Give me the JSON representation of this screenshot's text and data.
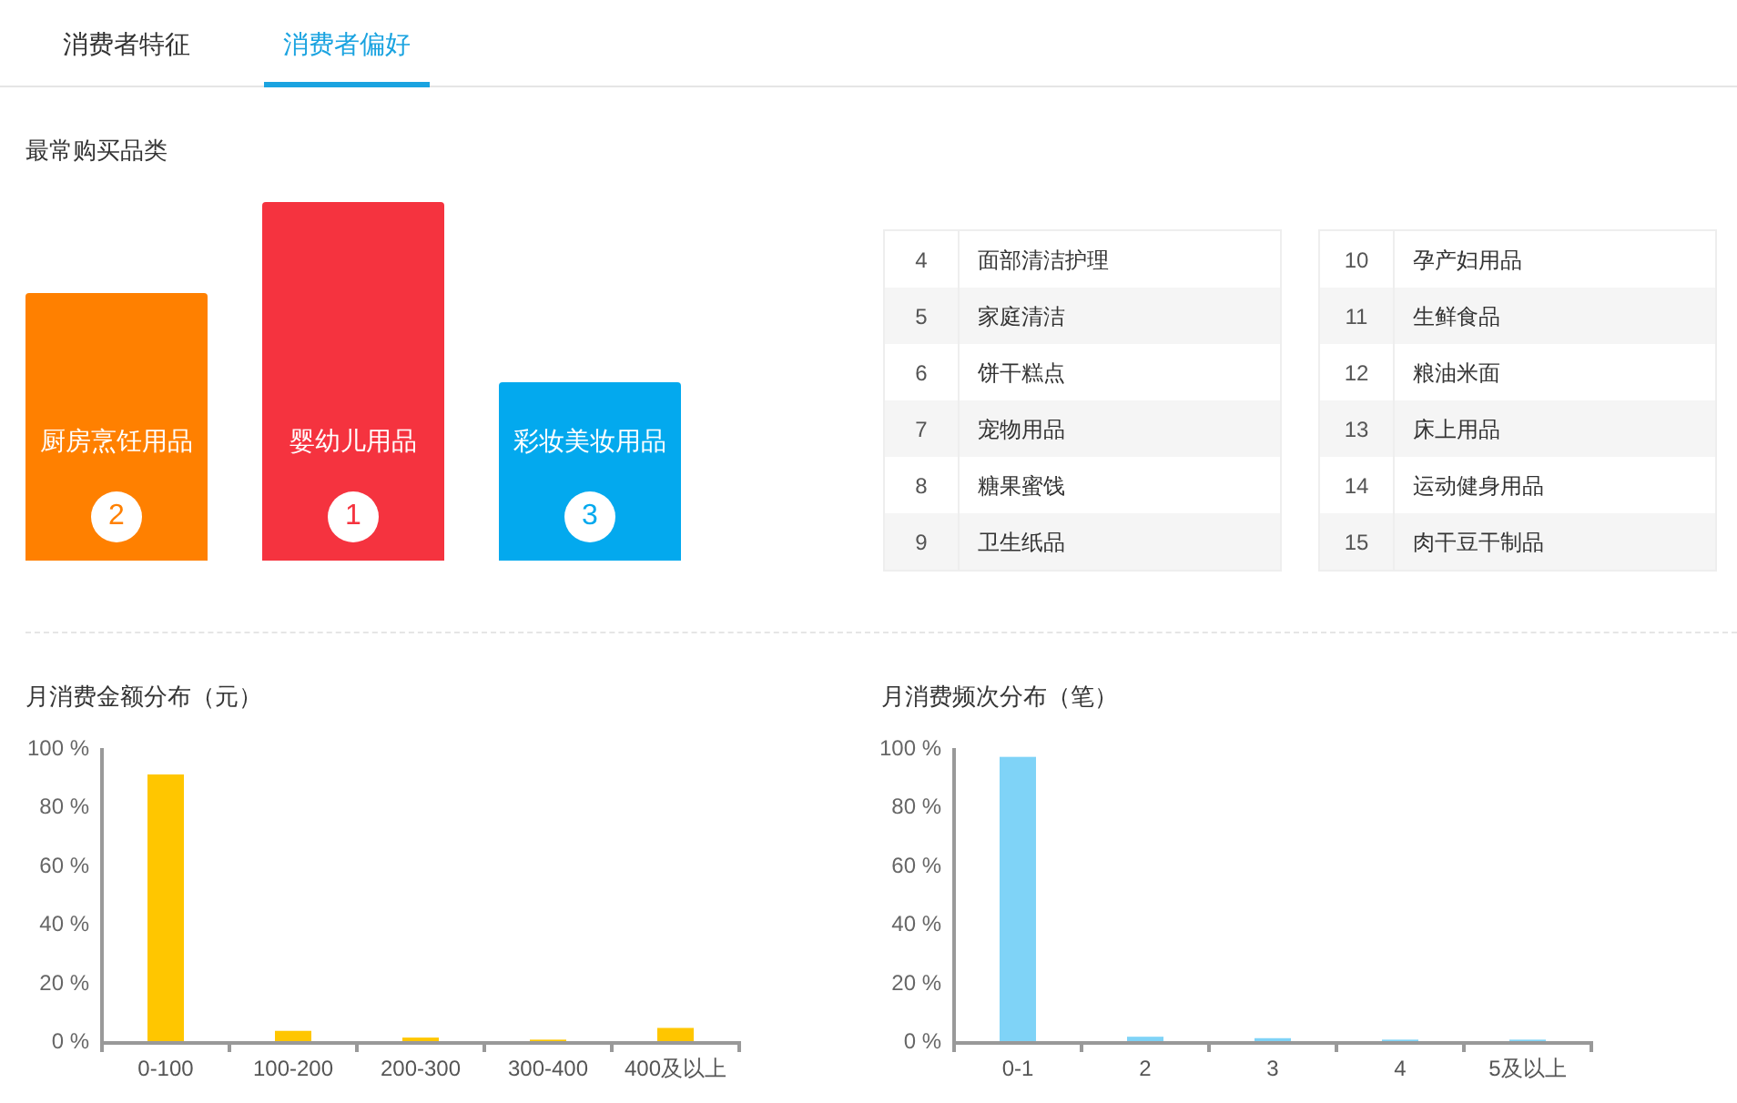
{
  "tabs": [
    {
      "label": "消费者特征",
      "selected": false
    },
    {
      "label": "消费者偏好",
      "selected": true
    }
  ],
  "top_categories": {
    "title": "最常购买品类",
    "items": [
      {
        "name": "厨房烹饪用品",
        "rank": "2",
        "color": "#ff8000"
      },
      {
        "name": "婴幼儿用品",
        "rank": "1",
        "color": "#f5333f"
      },
      {
        "name": "彩妆美妆用品",
        "rank": "3",
        "color": "#03a9ee"
      }
    ]
  },
  "ranking_tables": [
    [
      {
        "rank": "4",
        "name": "面部清洁护理"
      },
      {
        "rank": "5",
        "name": "家庭清洁"
      },
      {
        "rank": "6",
        "name": "饼干糕点"
      },
      {
        "rank": "7",
        "name": "宠物用品"
      },
      {
        "rank": "8",
        "name": "糖果蜜饯"
      },
      {
        "rank": "9",
        "name": "卫生纸品"
      }
    ],
    [
      {
        "rank": "10",
        "name": "孕产妇用品"
      },
      {
        "rank": "11",
        "name": "生鲜食品"
      },
      {
        "rank": "12",
        "name": "粮油米面"
      },
      {
        "rank": "13",
        "name": "床上用品"
      },
      {
        "rank": "14",
        "name": "运动健身用品"
      },
      {
        "rank": "15",
        "name": "肉干豆干制品"
      }
    ]
  ],
  "charts": [
    {
      "title": "月消费金额分布（元）",
      "chart_data": {
        "type": "bar",
        "categories": [
          "0-100",
          "100-200",
          "200-300",
          "300-400",
          "400及以上"
        ],
        "series": [
          {
            "color": "#ffc600",
            "values": [
              91,
              3.5,
              1.2,
              0.5,
              4.5
            ]
          }
        ],
        "ylim": [
          0,
          100
        ],
        "yticks": [
          {
            "value": 0,
            "label": "0 %"
          },
          {
            "value": 20,
            "label": "20 %"
          },
          {
            "value": 40,
            "label": "40 %"
          },
          {
            "value": 60,
            "label": "60 %"
          },
          {
            "value": 80,
            "label": "80 %"
          },
          {
            "value": 100,
            "label": "100 %"
          }
        ]
      }
    },
    {
      "title": "月消费频次分布（笔）",
      "chart_data": {
        "type": "bar",
        "categories": [
          "0-1",
          "2",
          "3",
          "4",
          "5及以上"
        ],
        "series": [
          {
            "color": "#7fd3f7",
            "values": [
              97,
              1.5,
              1,
              0.5,
              0.5
            ]
          }
        ],
        "ylim": [
          0,
          100
        ],
        "yticks": [
          {
            "value": 0,
            "label": "0 %"
          },
          {
            "value": 20,
            "label": "20 %"
          },
          {
            "value": 40,
            "label": "40 %"
          },
          {
            "value": 60,
            "label": "60 %"
          },
          {
            "value": 80,
            "label": "80 %"
          },
          {
            "value": 100,
            "label": "100 %"
          }
        ]
      }
    }
  ]
}
